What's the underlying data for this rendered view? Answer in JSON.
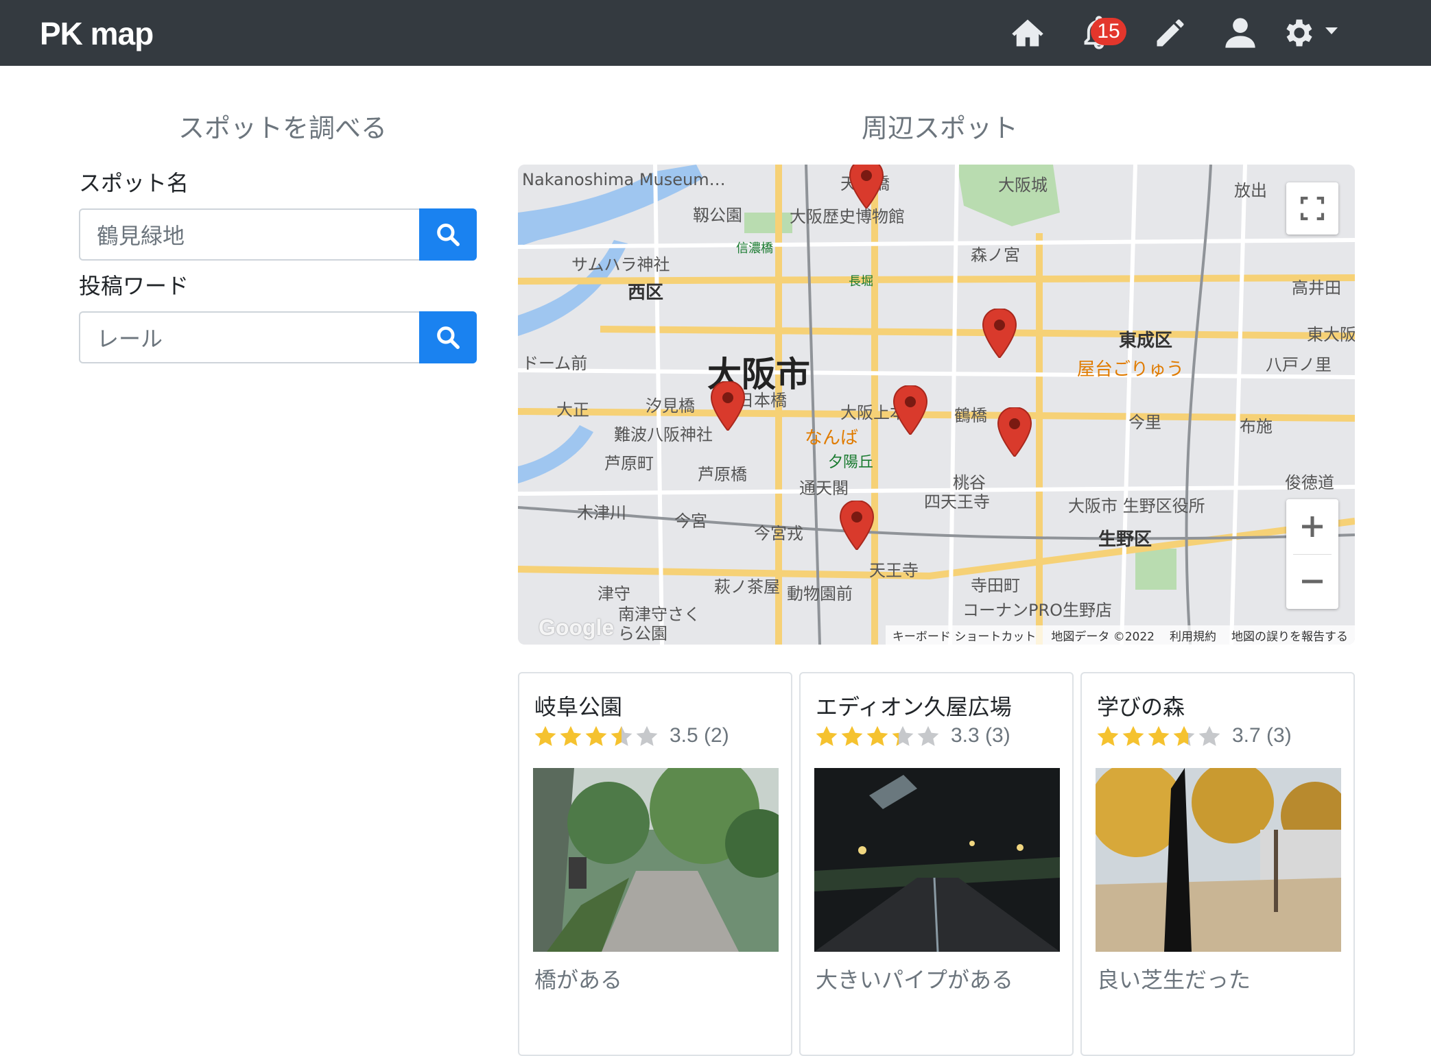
{
  "navbar": {
    "brand": "PK map",
    "notification_count": "15",
    "icons": [
      "home-icon",
      "bell-icon",
      "pencil-icon",
      "user-icon",
      "gear-icon"
    ]
  },
  "search_panel": {
    "title": "スポットを調べる",
    "spot_name_label": "スポット名",
    "spot_name_value": "鶴見緑地",
    "post_word_label": "投稿ワード",
    "post_word_value": "レール"
  },
  "nearby": {
    "title": "周辺スポット",
    "map": {
      "city_label": "大阪市",
      "labels": [
        "Nakanoshima Museum…",
        "天満橋",
        "大阪城",
        "放出",
        "靱公園",
        "大阪歴史博物館",
        "信濃橋",
        "森ノ宮",
        "サムハラ神社",
        "長堀",
        "高井田",
        "西区",
        "東成区",
        "屋台ごりゅう",
        "八戸ノ里",
        "東大阪",
        "ドーム前",
        "大正",
        "汐見橋",
        "日本橋",
        "大阪上本町",
        "鶴橋",
        "今里",
        "布施",
        "難波八阪神社",
        "なんば",
        "夕陽丘",
        "芦原町",
        "芦原橋",
        "桃谷",
        "俊徳道",
        "通天閣",
        "四天王寺",
        "大阪市 生野区役所",
        "木津川",
        "今宮",
        "今宮戎",
        "生野区",
        "天王寺",
        "津守",
        "萩ノ茶屋",
        "動物園前",
        "寺田町",
        "コーナンPRO生野店",
        "南津守さくら公園"
      ],
      "attribution": [
        "キーボード ショートカット",
        "地図データ ©2022",
        "利用規約",
        "地図の誤りを報告する"
      ],
      "logo": "Google"
    },
    "spots": [
      {
        "name": "岐阜公園",
        "rating": 3.5,
        "score_text": "3.5 (2)",
        "comment": "橋がある"
      },
      {
        "name": "エディオン久屋広場",
        "rating": 3.3,
        "score_text": "3.3 (3)",
        "comment": "大きいパイプがある"
      },
      {
        "name": "学びの森",
        "rating": 3.7,
        "score_text": "3.7 (3)",
        "comment": "良い芝生だった"
      }
    ]
  },
  "colors": {
    "navbar": "#343a40",
    "primary": "#1a82f0",
    "badge": "#e3362c",
    "star": "#f5c22f",
    "pin": "#d93a2c"
  }
}
